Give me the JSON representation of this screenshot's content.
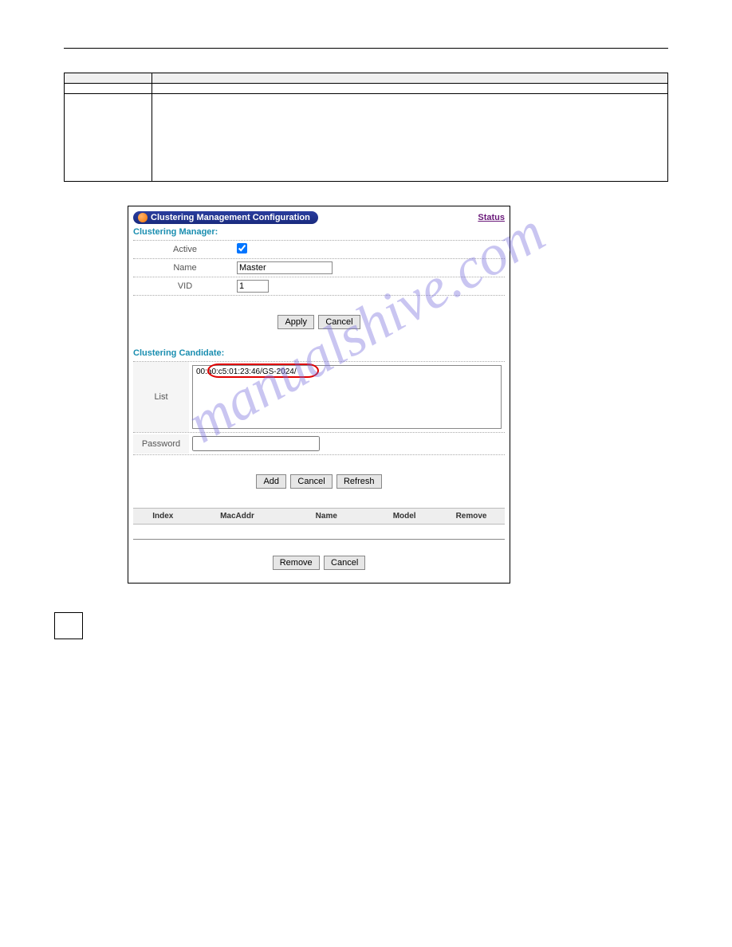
{
  "watermark": "manualshive.com",
  "spec_table": {
    "headers": [
      "",
      ""
    ],
    "rows": [
      [
        "",
        ""
      ],
      [
        "",
        ""
      ]
    ]
  },
  "panel": {
    "title": "Clustering Management Configuration",
    "status_link": "Status",
    "manager": {
      "heading": "Clustering Manager:",
      "active_label": "Active",
      "active_checked": true,
      "name_label": "Name",
      "name_value": "Master",
      "vid_label": "VID",
      "vid_value": "1"
    },
    "buttons": {
      "apply": "Apply",
      "cancel": "Cancel",
      "add": "Add",
      "refresh": "Refresh",
      "remove": "Remove"
    },
    "candidate": {
      "heading": "Clustering Candidate:",
      "list_label": "List",
      "list_items": [
        "00:a0:c5:01:23:46/GS-2024/"
      ],
      "password_label": "Password",
      "password_value": ""
    },
    "member_table": {
      "cols": [
        "Index",
        "MacAddr",
        "Name",
        "Model",
        "Remove"
      ]
    }
  }
}
